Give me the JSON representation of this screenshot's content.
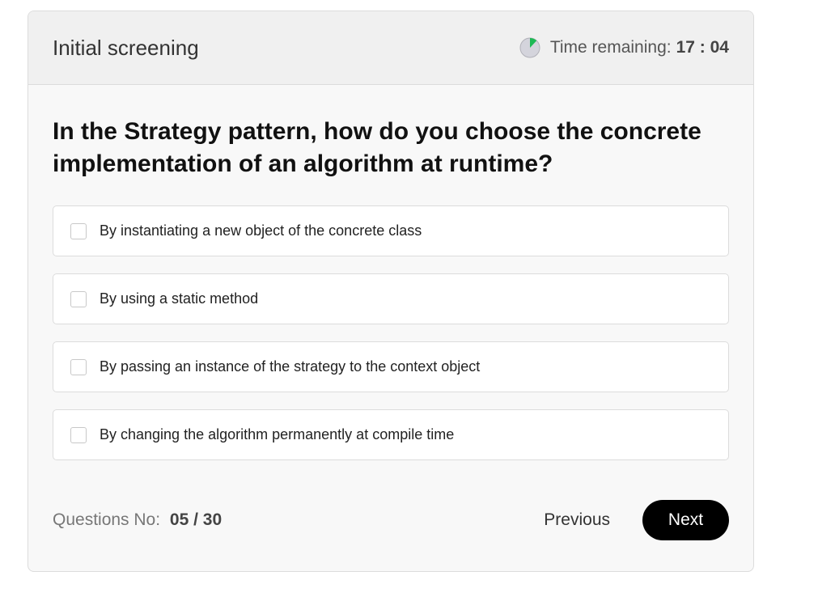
{
  "header": {
    "title": "Initial screening",
    "timer_icon": "pie-timer-icon",
    "timer_label": "Time remaining:",
    "timer_value": "17 : 04",
    "timer_progress_fraction": 0.12
  },
  "question": {
    "text": "In the Strategy pattern, how do you choose the concrete implementation of an algorithm at runtime?"
  },
  "options": [
    {
      "label": "By instantiating a new object of the concrete class",
      "checked": false
    },
    {
      "label": "By using a static method",
      "checked": false
    },
    {
      "label": "By passing an instance of the strategy to the context object",
      "checked": false
    },
    {
      "label": "By changing the algorithm permanently at compile time",
      "checked": false
    }
  ],
  "footer": {
    "question_no_label": "Questions No:",
    "question_no_value": "05 / 30",
    "previous_label": "Previous",
    "next_label": "Next"
  },
  "colors": {
    "accent_green": "#1db954",
    "button_bg": "#000000",
    "card_bg": "#f8f8f8",
    "header_bg": "#f0f0f0"
  }
}
